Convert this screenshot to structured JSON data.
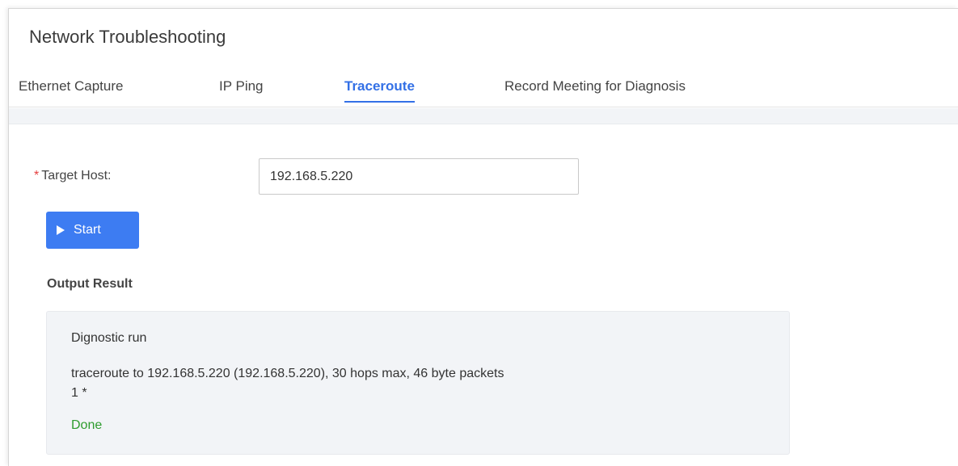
{
  "page": {
    "title": "Network Troubleshooting"
  },
  "tabs": [
    {
      "label": "Ethernet Capture",
      "active": false
    },
    {
      "label": "IP Ping",
      "active": false
    },
    {
      "label": "Traceroute",
      "active": true
    },
    {
      "label": "Record Meeting for Diagnosis",
      "active": false
    }
  ],
  "form": {
    "required_marker": "*",
    "target_host_label": "Target Host:",
    "target_host_value": "192.168.5.220"
  },
  "start_button": {
    "label": "Start",
    "icon": "play-icon"
  },
  "output": {
    "title": "Output Result",
    "lines": [
      "Dignostic run",
      "traceroute to 192.168.5.220 (192.168.5.220), 30 hops max, 46 byte packets",
      "1 *",
      "Done"
    ]
  },
  "colors": {
    "accent": "#3370e6",
    "button": "#3d7cf2",
    "required": "#e53e3e",
    "done": "#2e9c2e",
    "output_bg": "#f2f4f7"
  }
}
